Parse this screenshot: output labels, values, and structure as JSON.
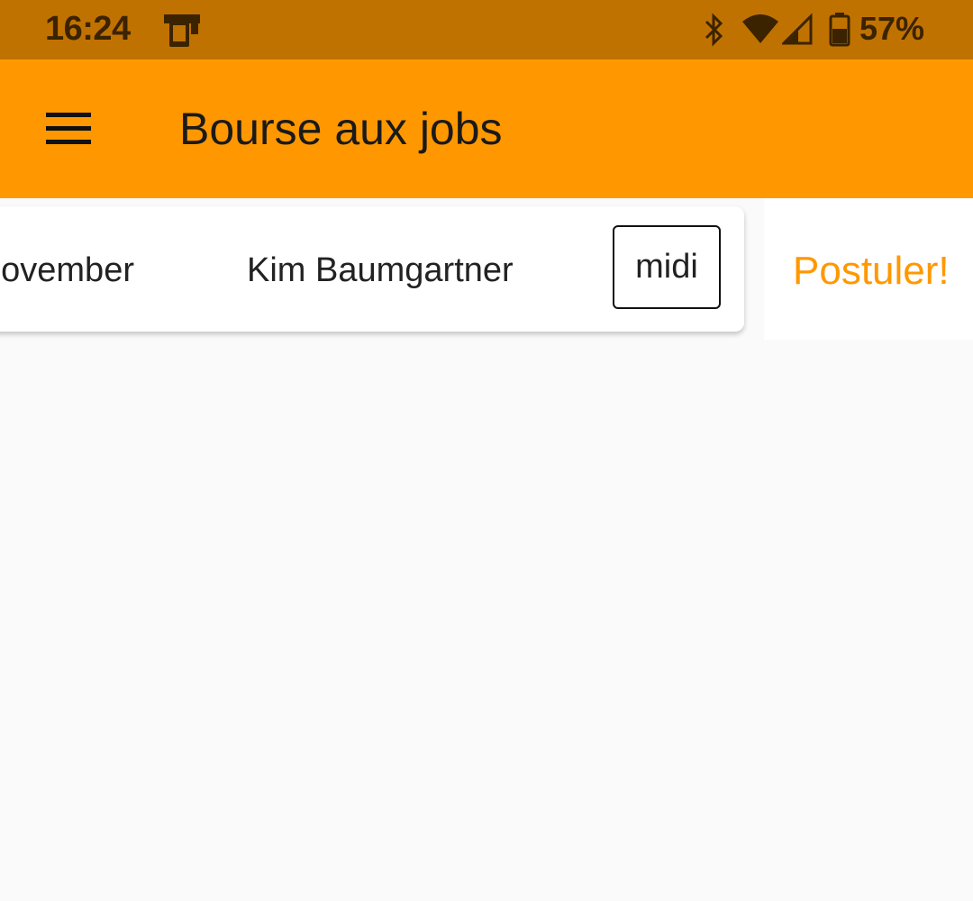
{
  "status_bar": {
    "time": "16:24",
    "battery_percent": "57%",
    "icons": [
      "notification-device-icon",
      "bluetooth-icon",
      "wifi-icon",
      "cell-signal-icon",
      "battery-icon"
    ]
  },
  "app_bar": {
    "title": "Bourse aux jobs",
    "menu_icon": "hamburger-menu-icon",
    "background_color": "#ff9800"
  },
  "job_list": [
    {
      "date": "november",
      "person": "Kim Baumgartner",
      "shift": "midi"
    }
  ],
  "apply": {
    "label": "Postuler!",
    "color": "#ff9800"
  }
}
